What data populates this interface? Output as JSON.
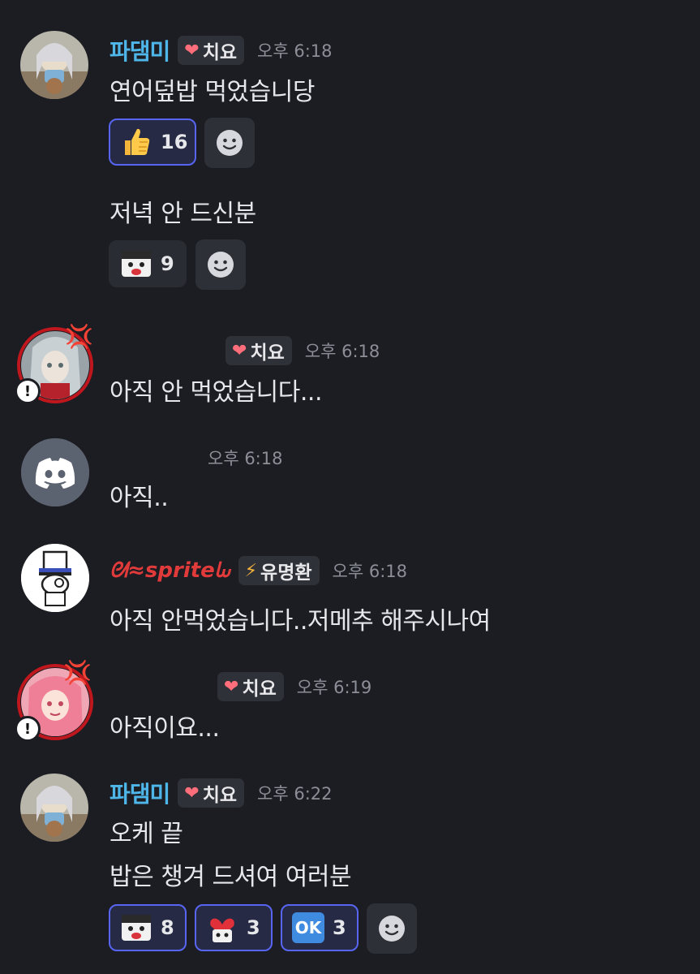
{
  "messages": [
    {
      "username": "파댐미",
      "tag": "치요",
      "time": "오후 6:18",
      "lines": [
        "연어덮밥 먹었습니당"
      ],
      "reactions": [
        {
          "emoji": "thumbs-up",
          "count": "16",
          "active": true
        }
      ]
    },
    {
      "lines": [
        "저녁 안 드신분"
      ],
      "reactions": [
        {
          "emoji": "custom-face",
          "count": "9",
          "active": false
        }
      ]
    },
    {
      "username": "",
      "tag": "치요",
      "time": "오후 6:18",
      "lines": [
        "아직 안 먹었습니다..."
      ]
    },
    {
      "username": "",
      "time": "오후 6:18",
      "lines": [
        "아직.."
      ]
    },
    {
      "username": "sprite",
      "tag": "유명환",
      "time": "오후 6:18",
      "lines": [
        "아직 안먹었습니다..저메추 해주시나여"
      ]
    },
    {
      "username": "",
      "tag": "치요",
      "time": "오후 6:19",
      "lines": [
        "아직이요..."
      ]
    },
    {
      "username": "파댐미",
      "tag": "치요",
      "time": "오후 6:22",
      "lines": [
        "오케 끝",
        "밥은 챙겨 드셔여 여러분"
      ],
      "reactions": [
        {
          "emoji": "custom-face",
          "count": "8",
          "active": true
        },
        {
          "emoji": "custom-heart-face",
          "count": "3",
          "active": true
        },
        {
          "emoji": "ok-button",
          "label": "OK",
          "count": "3",
          "active": true
        }
      ]
    }
  ],
  "colors": {
    "background": "#1c1d22",
    "username": "#4fb6ea",
    "active_reaction_border": "#5865f2",
    "sprite_name": "#e03a3a"
  }
}
